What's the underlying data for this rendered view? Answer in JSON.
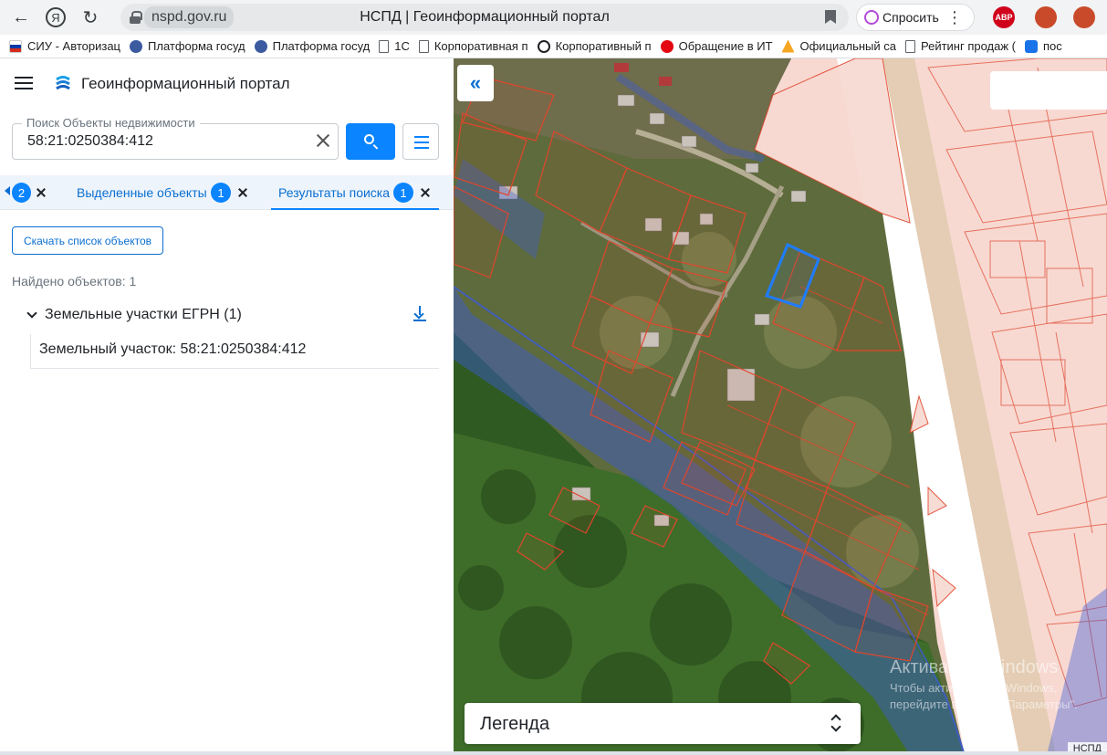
{
  "browser": {
    "url": "nspd.gov.ru",
    "tab_title": "НСПД | Геоинформационный портал",
    "ask_label": "Спросить",
    "extension_abp": "ABP",
    "bookmarks": [
      {
        "label": "СИУ - Авторизац",
        "icon": "flag-icon"
      },
      {
        "label": "Платформа госуд",
        "icon": "eagle-icon"
      },
      {
        "label": "Платформа госуд",
        "icon": "eagle-icon"
      },
      {
        "label": "1С",
        "icon": "page-icon"
      },
      {
        "label": "Корпоративная п",
        "icon": "page-icon"
      },
      {
        "label": "Корпоративный п",
        "icon": "circle-arrow-icon"
      },
      {
        "label": "Обращение в ИТ",
        "icon": "mts-icon"
      },
      {
        "label": "Официальный са",
        "icon": "triangle-icon"
      },
      {
        "label": "Рейтинг продаж (",
        "icon": "page-icon"
      },
      {
        "label": "пос",
        "icon": "cube-icon"
      }
    ]
  },
  "app": {
    "title": "Геоинформационный портал"
  },
  "search": {
    "label": "Поиск Объекты недвижимости",
    "value": "58:21:0250384:412"
  },
  "tabs": [
    {
      "label": "",
      "count": "2"
    },
    {
      "label": "Выделенные объекты",
      "count": "1"
    },
    {
      "label": "Результаты поиска",
      "count": "1",
      "active": true
    }
  ],
  "results": {
    "download_list_label": "Скачать список объектов",
    "found_text": "Найдено объектов: 1",
    "group_label": "Земельные участки ЕГРН (1)",
    "items": [
      "Земельный участок: 58:21:0250384:412"
    ]
  },
  "map": {
    "legend_label": "Легенда",
    "attribution": "НСПД",
    "watermark_title": "Активация Windows",
    "watermark_text": "Чтобы активировать Windows, перейдите в раздел \"Параметры\".",
    "colors": {
      "accent": "#0a84ff",
      "parcel_border": "#e0462c",
      "selected_parcel": "#1f7cff",
      "cadastral_fill": "#f7d9d2",
      "water_zone": "#3b5bd6"
    }
  }
}
